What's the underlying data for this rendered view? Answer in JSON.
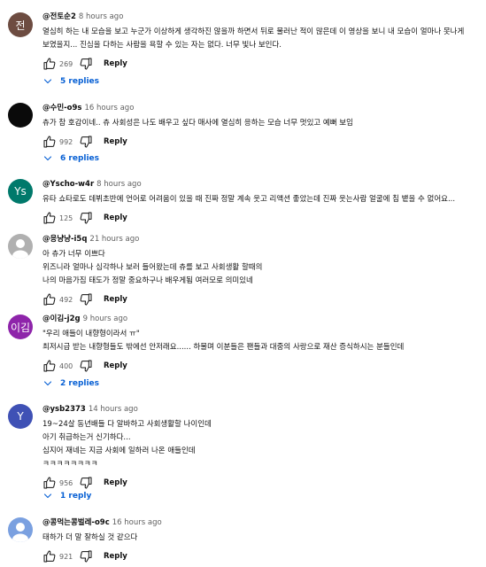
{
  "comments": [
    {
      "handle": "@전토순2",
      "time": "8 hours ago",
      "avatar": {
        "text": "전",
        "bg": "#6d4c41"
      },
      "lines": [
        "열심히 하는 내 모습을 보고 누군가 이상하게 생각하진 않을까 하면서 뒤로 물러난 적이 많은데 이 영상을 보니 내 모습이 얼마나 못나게",
        "보였을지... 진심을 다하는 사람을 욕할 수 있는 자는 없다. 너무 빛나 보인다."
      ],
      "likes": "269",
      "reply_label": "Reply",
      "replies_label": "5 replies"
    },
    {
      "handle": "@수민-o9s",
      "time": "16 hours ago",
      "avatar": {
        "text": "",
        "bg": "#0a0a0a"
      },
      "lines": [
        "츄가 참 호감이네.. 츄 사회성은 나도 배우고 싶다 매사에 열심히 응하는 모습 너무 멋있고 예뻐 보임"
      ],
      "likes": "992",
      "reply_label": "Reply",
      "replies_label": "6 replies"
    },
    {
      "handle": "@Yscho-w4r",
      "time": "8 hours ago",
      "avatar": {
        "text": "Ys",
        "bg": "#00796b"
      },
      "lines": [
        "유타 쇼타로도 데뷔초반에 언어로 어려움이 있을 때 진짜 정말 계속 웃고 리액션 좋았는데 진짜 웃는사람 얼굴에 침 뱉을 수 없어요..."
      ],
      "likes": "125",
      "reply_label": "Reply"
    },
    {
      "handle": "@응냥냥-i5q",
      "time": "21 hours ago",
      "avatar": {
        "text": "",
        "bg": "#b0b0b0"
      },
      "lines": [
        "아 츄가 너무 이쁘다",
        "위즈니라 얼마나 심각하나 보러 들어왔는데 츄를 보고 사회생활 할때의",
        "나의 마음가짐 태도가 정말 중요하구나 배우게됨 여러모로 의미있네"
      ],
      "likes": "492",
      "reply_label": "Reply"
    },
    {
      "handle": "@이김-j2g",
      "time": "9 hours ago",
      "avatar": {
        "text": "이김",
        "bg": "#8e24aa"
      },
      "lines": [
        "\"우리 애들이 내향형이라서 ㅠ\"",
        "최저시급 받는 내향형들도 밖에선 안저래요...... 하물며 이분들은 팬들과 대중의 사랑으로 재산 증식하시는 분들인데"
      ],
      "likes": "400",
      "reply_label": "Reply",
      "replies_label": "2 replies"
    },
    {
      "handle": "@ysb2373",
      "time": "14 hours ago",
      "avatar": {
        "text": "Y",
        "bg": "#3f51b5"
      },
      "lines": [
        "19~24살 동년배들 다 알바하고 사회생활할 나이인데",
        "아기 취급하는거 신기하다...",
        "심지어 재네는 지금 사회에 일하러 나온 애들인데",
        "ㅋㅋㅋㅋㅋㅋㅋㅋ"
      ],
      "likes": "956",
      "reply_label": "Reply",
      "replies_label": "1 reply"
    },
    {
      "handle": "@콩먹는콩벌레-o9c",
      "time": "16 hours ago",
      "avatar": {
        "text": "",
        "bg": "#7aa0e0"
      },
      "lines": [
        "태하가 더 말 잘하실 것 같으다"
      ],
      "likes": "921",
      "reply_label": "Reply"
    }
  ]
}
